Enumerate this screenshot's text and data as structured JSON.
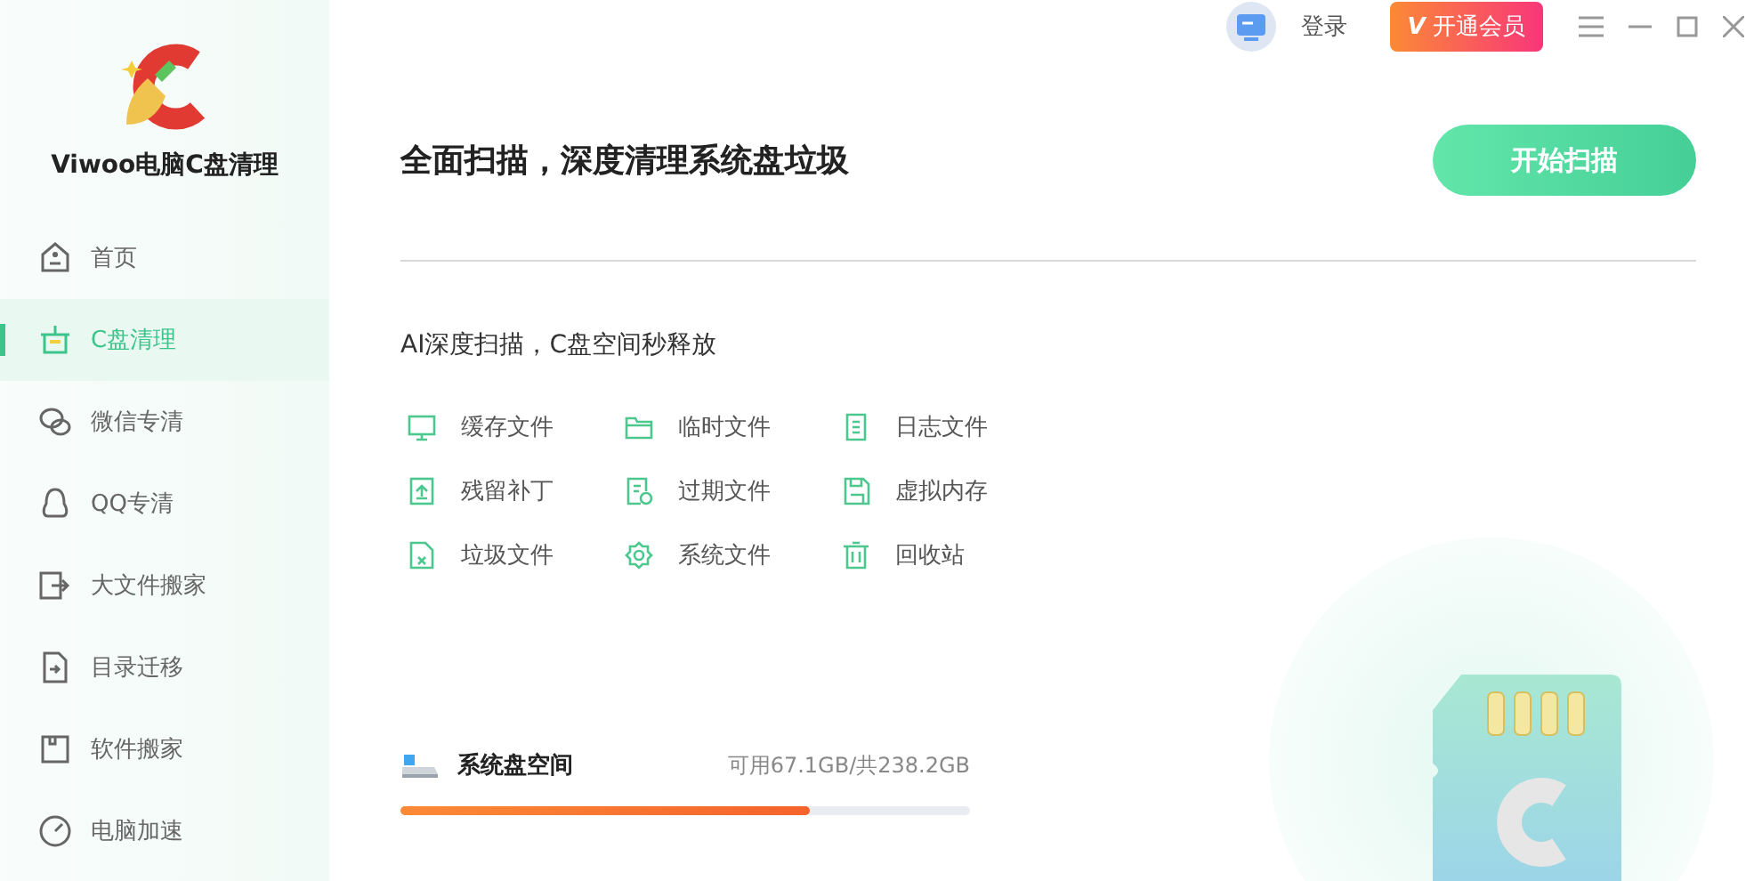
{
  "app": {
    "name": "Viwoo电脑C盘清理"
  },
  "sidebar": {
    "items": [
      {
        "label": "首页",
        "selected": false
      },
      {
        "label": "C盘清理",
        "selected": true
      },
      {
        "label": "微信专清",
        "selected": false
      },
      {
        "label": "QQ专清",
        "selected": false
      },
      {
        "label": "大文件搬家",
        "selected": false
      },
      {
        "label": "目录迁移",
        "selected": false
      },
      {
        "label": "软件搬家",
        "selected": false
      },
      {
        "label": "电脑加速",
        "selected": false
      }
    ]
  },
  "topbar": {
    "login": "登录",
    "vip_mark": "V",
    "vip": "开通会员"
  },
  "main": {
    "title": "全面扫描，深度清理系统盘垃圾",
    "scan_button": "开始扫描",
    "subtitle": "AI深度扫描，C盘空间秒释放",
    "categories": [
      {
        "label": "缓存文件"
      },
      {
        "label": "临时文件"
      },
      {
        "label": "日志文件"
      },
      {
        "label": "残留补丁"
      },
      {
        "label": "过期文件"
      },
      {
        "label": "虚拟内存"
      },
      {
        "label": "垃圾文件"
      },
      {
        "label": "系统文件"
      },
      {
        "label": "回收站"
      }
    ],
    "disk": {
      "label": "系统盘空间",
      "info": "可用67.1GB/共238.2GB",
      "level": 0.72
    }
  }
}
